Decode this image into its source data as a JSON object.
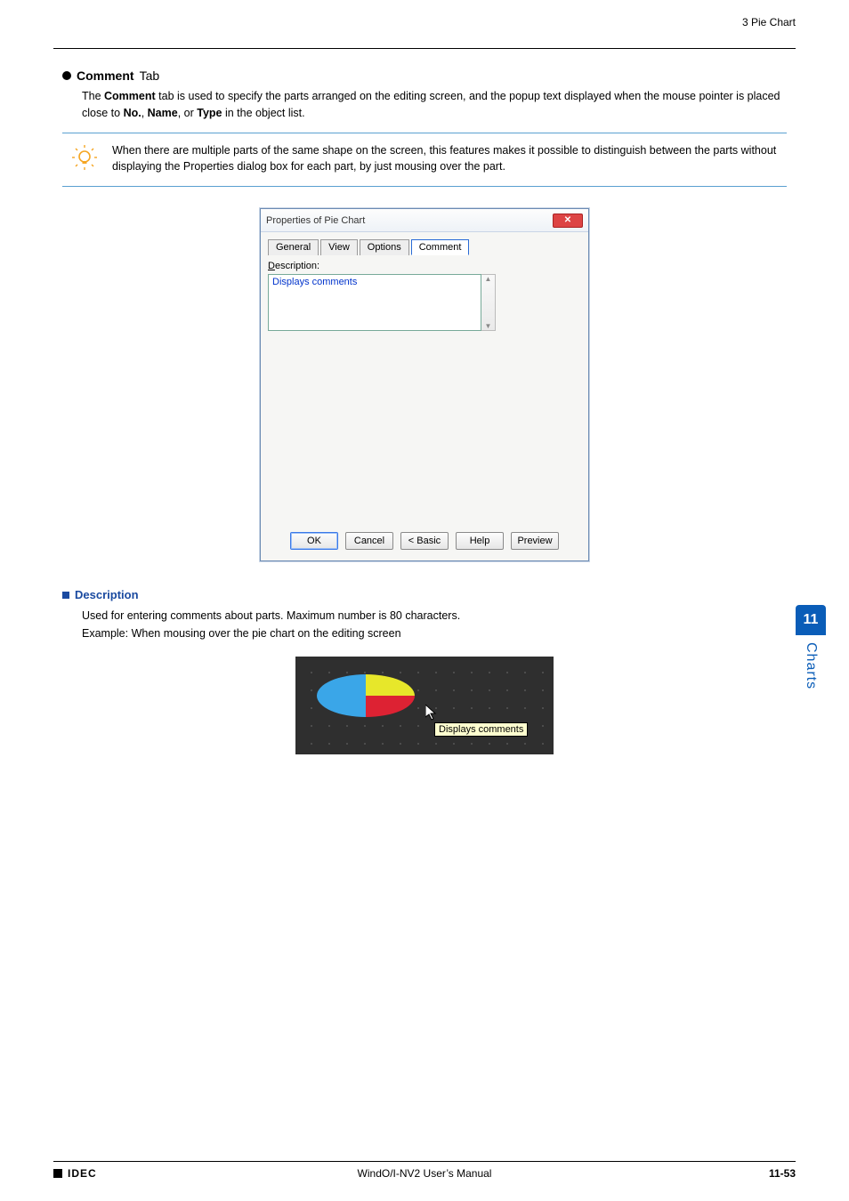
{
  "header": {
    "breadcrumb": "3 Pie Chart"
  },
  "section": {
    "title_strong": "Comment",
    "title_rest": "Tab",
    "intro_pre": "The ",
    "intro_bold1": "Comment",
    "intro_mid1": " tab is used to specify the parts arranged on the editing screen, and the popup text displayed when the mouse pointer is placed close to ",
    "intro_bold2": "No.",
    "intro_sep1": ", ",
    "intro_bold3": "Name",
    "intro_sep2": ", or ",
    "intro_bold4": "Type",
    "intro_end": " in the object list."
  },
  "tip": {
    "text": "When there are multiple parts of the same shape on the screen, this features makes it possible to distinguish between the parts without displaying the Properties dialog box for each part, by just mousing over the part."
  },
  "dialog": {
    "title": "Properties of Pie Chart",
    "close_glyph": "✕",
    "tabs": {
      "general": "General",
      "view": "View",
      "options": "Options",
      "comment": "Comment"
    },
    "field_label_pre": "D",
    "field_label_rest": "escription:",
    "textarea_value": "Displays comments",
    "scroll_up": "▲",
    "scroll_down": "▼",
    "buttons": {
      "ok": "OK",
      "cancel": "Cancel",
      "basic": "< Basic",
      "help": "Help",
      "preview": "Preview"
    }
  },
  "description": {
    "heading": "Description",
    "line1": "Used for entering comments about parts. Maximum number is 80 characters.",
    "line2": "Example: When mousing over the pie chart on the editing screen"
  },
  "tooltip_text": "Displays comments",
  "side": {
    "number": "11",
    "label": "Charts"
  },
  "footer": {
    "brand": "IDEC",
    "center": "WindO/I-NV2 User’s Manual",
    "page": "11-53"
  }
}
